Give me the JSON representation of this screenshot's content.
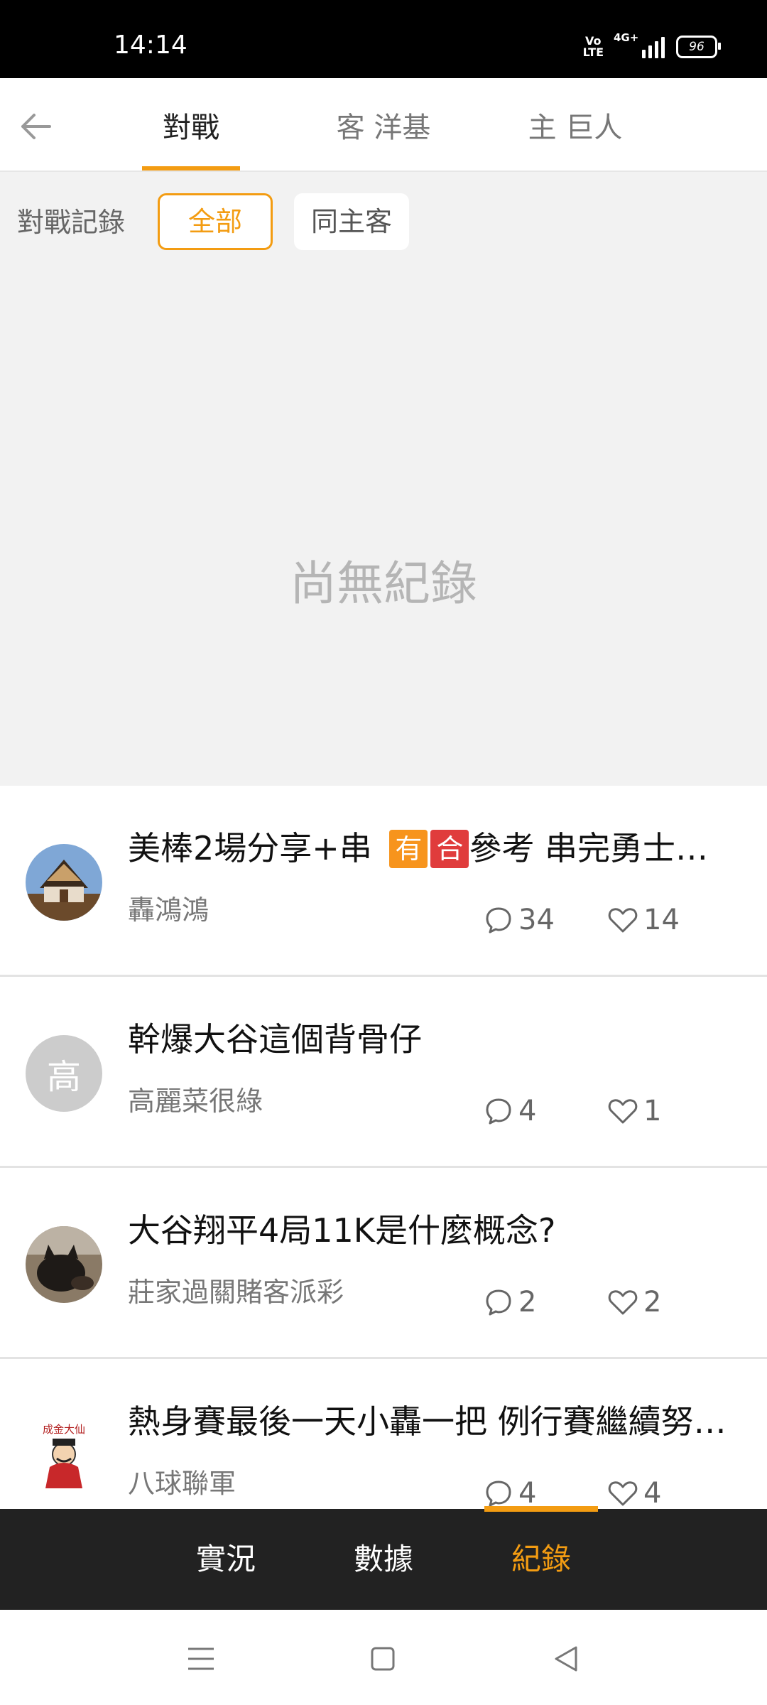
{
  "status_bar": {
    "time": "14:14",
    "network": "4G+",
    "volte": "Vo LTE",
    "battery": "96"
  },
  "top_tabs": [
    {
      "label": "對戰",
      "active": true
    },
    {
      "label": "客 洋基",
      "active": false
    },
    {
      "label": "主 巨人",
      "active": false
    }
  ],
  "filter": {
    "label": "對戰記錄",
    "options": [
      {
        "label": "全部",
        "selected": true
      },
      {
        "label": "同主客",
        "selected": false
      }
    ]
  },
  "empty_message": "尚無紀錄",
  "posts": [
    {
      "title": "美棒2場分享+串 ",
      "tag1": "有",
      "tag2": "合",
      "title_rest": "參考   串完勇士…",
      "author": "轟鴻鴻",
      "comments": "34",
      "likes": "14",
      "avatar": "temple-photo"
    },
    {
      "title": "幹爆大谷這個背骨仔",
      "author": "高麗菜很綠",
      "comments": "4",
      "likes": "1",
      "avatar_letter": "高"
    },
    {
      "title": "大谷翔平4局11K是什麼概念?",
      "author": "莊家過關賭客派彩",
      "comments": "2",
      "likes": "2",
      "avatar": "dog-photo"
    },
    {
      "title": "熱身賽最後一天小轟一把 例行賽繼續努…",
      "author": "八球聯軍",
      "comments": "4",
      "likes": "4",
      "avatar": "fortune-god-image",
      "avatar_text": "成金大仙"
    }
  ],
  "bottom_tabs": [
    {
      "label": "實況",
      "active": false
    },
    {
      "label": "數據",
      "active": false
    },
    {
      "label": "紀錄",
      "active": true
    }
  ],
  "colors": {
    "accent": "#f39c12",
    "tag_you": "#f7941d",
    "tag_he": "#e03c3c",
    "bottom_bar": "#222222"
  }
}
